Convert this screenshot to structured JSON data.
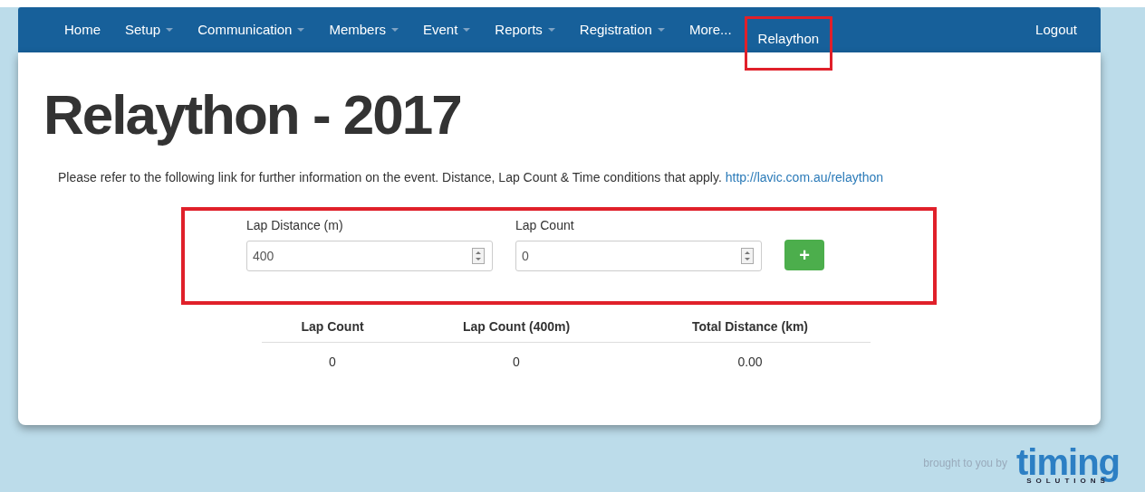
{
  "navbar": {
    "items": [
      {
        "label": "Home",
        "dropdown": false,
        "highlighted": false
      },
      {
        "label": "Setup",
        "dropdown": true,
        "highlighted": false
      },
      {
        "label": "Communication",
        "dropdown": true,
        "highlighted": false
      },
      {
        "label": "Members",
        "dropdown": true,
        "highlighted": false
      },
      {
        "label": "Event",
        "dropdown": true,
        "highlighted": false
      },
      {
        "label": "Reports",
        "dropdown": true,
        "highlighted": false
      },
      {
        "label": "Registration",
        "dropdown": true,
        "highlighted": false
      },
      {
        "label": "More...",
        "dropdown": false,
        "highlighted": false
      },
      {
        "label": "Relaython",
        "dropdown": false,
        "highlighted": true
      }
    ],
    "logout": "Logout"
  },
  "title": "Relaython - 2017",
  "intro": {
    "text": "Please refer to the following link for further information on the event. Distance, Lap Count & Time conditions that apply.",
    "link": "http://lavic.com.au/relaython"
  },
  "form": {
    "highlighted": true,
    "fields": [
      {
        "label": "Lap Distance (m)",
        "value": "400"
      },
      {
        "label": "Lap Count",
        "value": "0"
      }
    ],
    "add_button": "+"
  },
  "table": {
    "columns": [
      "Lap Count",
      "Lap Count (400m)",
      "Total Distance (km)"
    ],
    "rows": [
      [
        "0",
        "0",
        "0.00"
      ]
    ]
  },
  "footer": {
    "text": "brought to you by",
    "logo": "timing",
    "logo_sub": "SOLUTIONS"
  }
}
